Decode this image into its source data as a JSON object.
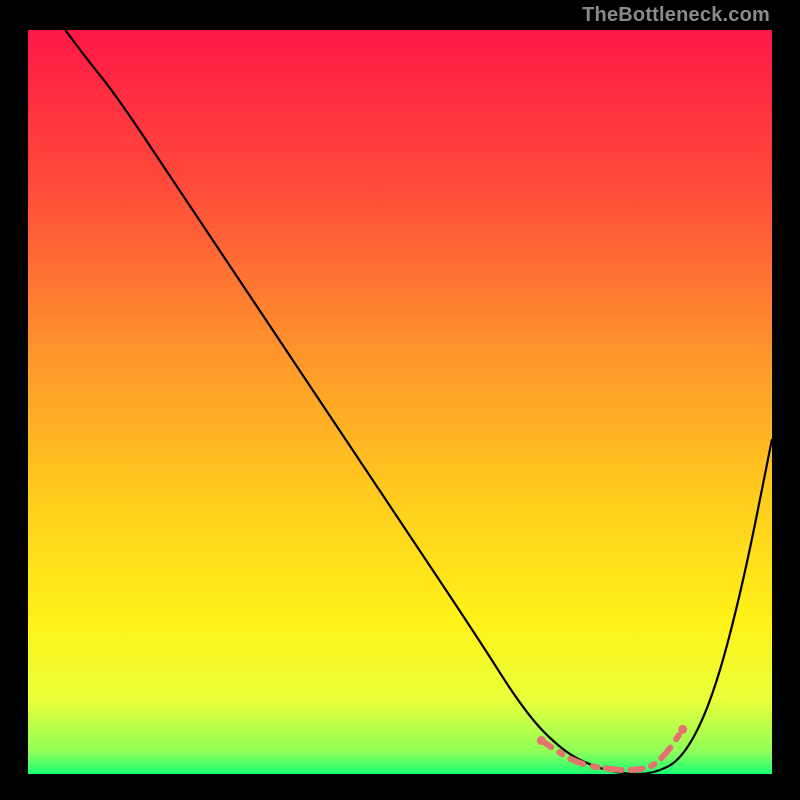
{
  "watermark": "TheBottleneck.com",
  "chart_data": {
    "type": "line",
    "title": "",
    "xlabel": "",
    "ylabel": "",
    "xlim": [
      0,
      100
    ],
    "ylim": [
      0,
      100
    ],
    "grid": false,
    "legend": false,
    "gradient_stops": [
      {
        "offset": 0,
        "color": "#ff1846"
      },
      {
        "offset": 22,
        "color": "#ff4e3a"
      },
      {
        "offset": 45,
        "color": "#ff9a2a"
      },
      {
        "offset": 65,
        "color": "#ffd21c"
      },
      {
        "offset": 80,
        "color": "#fff31a"
      },
      {
        "offset": 90,
        "color": "#e9ff3a"
      },
      {
        "offset": 97,
        "color": "#8fff58"
      },
      {
        "offset": 100,
        "color": "#19ff73"
      }
    ],
    "series": [
      {
        "name": "bottleneck-curve",
        "color": "#000000",
        "x": [
          5,
          8,
          12,
          20,
          30,
          40,
          50,
          60,
          67,
          72,
          76,
          80,
          84,
          88,
          92,
          96,
          100
        ],
        "y": [
          100,
          96,
          91,
          79,
          64,
          49,
          34,
          19,
          8,
          3,
          1,
          0,
          0,
          2,
          10,
          25,
          45
        ]
      },
      {
        "name": "trough-highlight",
        "color": "#e4736f",
        "x": [
          69,
          72,
          74,
          76,
          78,
          80,
          82,
          84,
          86,
          88
        ],
        "y": [
          4.5,
          2.5,
          1.5,
          1,
          0.7,
          0.5,
          0.6,
          1,
          3,
          6
        ],
        "style": "dashed"
      }
    ]
  }
}
